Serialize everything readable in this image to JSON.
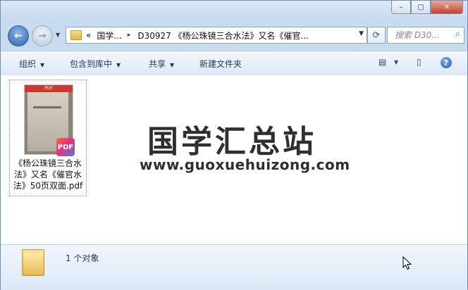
{
  "window": {
    "caption_buttons": [
      "–",
      "▢",
      "✕"
    ]
  },
  "nav": {
    "back_glyph": "←",
    "forward_glyph": "→",
    "recent_glyph": "▼",
    "breadcrumb": [
      "«",
      "国学...",
      "D30927 《杨公珠镜三合水法》又名《催官..."
    ],
    "separator": "▸",
    "dropdown_glyph": "▼",
    "refresh_glyph": "⟳",
    "search_placeholder": "搜索 D30...",
    "search_glyph": "⌕"
  },
  "toolbar": {
    "items": [
      "组织",
      "包含到库中",
      "共享",
      "新建文件夹"
    ],
    "arrow": "▼",
    "view_glyph": "▤",
    "view_arrow": "▼",
    "preview_glyph": "▯",
    "help_glyph": "?"
  },
  "content": {
    "file": {
      "thumb_label": "PDF",
      "badge": "PDF",
      "name": "《杨公珠镜三合水法》又名《催官水法》50页双面.pdf"
    },
    "watermark_title": "国学汇总站",
    "watermark_url": "www.guoxuehuizong.com"
  },
  "details": {
    "count": "1 个对象"
  },
  "colors": {
    "accent": "#2a63b0",
    "window_frame": "#c9dbef",
    "close_button": "#c4422d"
  }
}
